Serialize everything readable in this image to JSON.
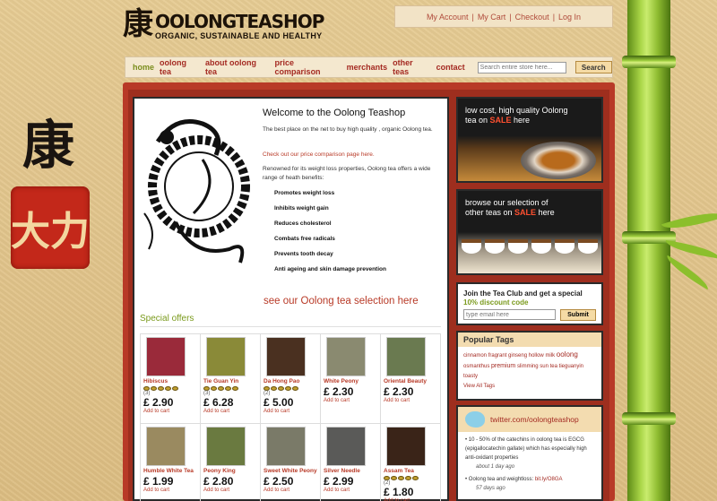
{
  "brand": {
    "kanji_left": "康",
    "seal_text": "大力",
    "logo_kanji": "康",
    "logo_name": "OOLONGTEASHOP",
    "logo_tagline": "ORGANIC, SUSTAINABLE AND HEALTHY"
  },
  "account": {
    "links": [
      "My Account",
      "My Cart",
      "Checkout",
      "Log In"
    ]
  },
  "nav": {
    "items": [
      "home",
      "oolong tea",
      "about oolong tea",
      "price comparison",
      "merchants",
      "other teas",
      "contact"
    ],
    "active": "home",
    "search_placeholder": "Search entire store here...",
    "search_button": "Search"
  },
  "welcome": {
    "title": "Welcome to the Oolong Teashop",
    "intro": "The best place on the net to buy high quality , organic Oolong tea.",
    "price_link": "Check out our price comparison page here.",
    "benefits_intro": "Renowned for its weight loss properties, Oolong tea offers a wide range of heath benefits:",
    "benefits": [
      "Promotes weight loss",
      "Inhibits weight gain",
      "Reduces cholesterol",
      "Combats free radicals",
      "Prevents tooth decay",
      "Anti ageing and skin damage prevention"
    ],
    "see_selection": "see our Oolong tea selection here"
  },
  "special": {
    "heading": "Special offers",
    "add_label": "Add to cart",
    "products": [
      {
        "name": "Hibiscus",
        "rating": "(3)",
        "price": "£ 2.90",
        "color": "#9a2a3a",
        "stars": 5
      },
      {
        "name": "Tie Guan Yin",
        "rating": "(3)",
        "price": "£ 6.28",
        "color": "#8a8a38",
        "stars": 5
      },
      {
        "name": "Da Hong Pao",
        "rating": "(2)",
        "price": "£ 5.00",
        "color": "#4a3020",
        "stars": 5
      },
      {
        "name": "White Peony",
        "rating": "",
        "price": "£ 2.30",
        "color": "#8a8a70",
        "stars": 0
      },
      {
        "name": "Oriental Beauty",
        "rating": "",
        "price": "£ 2.30",
        "color": "#6a7a50",
        "stars": 0
      },
      {
        "name": "Humble White Tea",
        "rating": "",
        "price": "£ 1.99",
        "color": "#9a8a60",
        "stars": 0
      },
      {
        "name": "Peony King",
        "rating": "",
        "price": "£ 2.80",
        "color": "#6a7a40",
        "stars": 0
      },
      {
        "name": "Sweet White Peony",
        "rating": "",
        "price": "£ 2.50",
        "color": "#7a7a68",
        "stars": 0
      },
      {
        "name": "Silver Needle",
        "rating": "",
        "price": "£ 2.99",
        "color": "#5a5a58",
        "stars": 0
      },
      {
        "name": "Assam Tea",
        "rating": "(2)",
        "price": "£ 1.80",
        "color": "#3a2418",
        "stars": 5
      }
    ]
  },
  "promos": [
    {
      "line1": "low cost, high quality Oolong",
      "line2_pre": "tea on ",
      "sale": "SALE",
      "line2_post": " here"
    },
    {
      "line1": "browse our selection of",
      "line2_pre": "other teas on ",
      "sale": "SALE",
      "line2_post": " here"
    }
  ],
  "club": {
    "title_pre": "Join the Tea Club and get a special ",
    "discount": "10% discount code",
    "email_placeholder": "type email here",
    "submit": "Submit"
  },
  "tags": {
    "heading": "Popular Tags",
    "items": [
      "cinnamon",
      "fragrant",
      "ginseng",
      "hollow",
      "milk",
      "oolong",
      "osmanthus",
      "premium",
      "slimming",
      "sun",
      "tea",
      "tieguanyin",
      "toasty"
    ],
    "view_all": "View All Tags"
  },
  "twitter": {
    "handle": "twitter.com/oolongteashop",
    "tweets": [
      {
        "text": "10 - 50% of the catechins in oolong tea is EGCG (epigallocatechin gallate) which has especially high anti-oxidant properties",
        "time": "about 1 day ago",
        "link": ""
      },
      {
        "text": "Oolong tea and weightloss: ",
        "link": "bit.ly/O8GA",
        "time": "57 days ago"
      }
    ]
  }
}
